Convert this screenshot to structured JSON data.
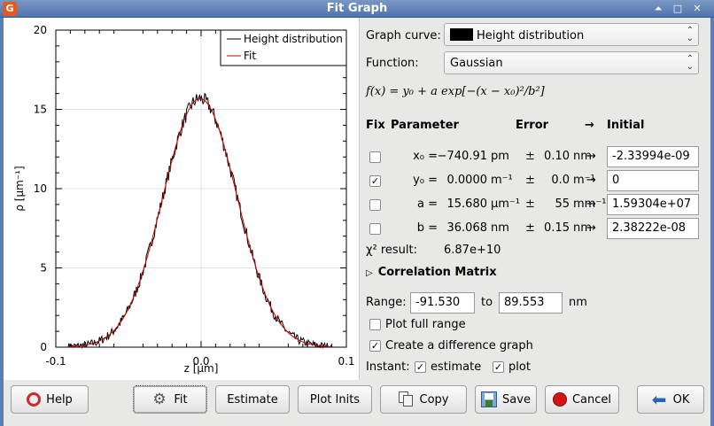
{
  "window": {
    "title": "Fit Graph"
  },
  "graph_curve": {
    "label": "Graph curve:",
    "value": "Height distribution"
  },
  "function": {
    "label": "Function:",
    "value": "Gaussian"
  },
  "formula": "f(x) = y₀ + a exp[−(x − x₀)²/b²]",
  "table": {
    "headers": {
      "fix": "Fix",
      "parameter": "Parameter",
      "error": "Error",
      "arrow": "→",
      "initial": "Initial"
    },
    "rows": [
      {
        "param": "x₀ =",
        "value": "−740.91",
        "unit": "pm",
        "pm": "±",
        "error": "0.10",
        "err_unit": "nm",
        "arrow": "→",
        "initial": "-2.33994e-09",
        "fixed": false
      },
      {
        "param": "y₀ =",
        "value": "0.0000",
        "unit": "m⁻¹",
        "pm": "±",
        "error": "0.0",
        "err_unit": "m⁻¹",
        "arrow": "→",
        "initial": "0",
        "fixed": true
      },
      {
        "param": "a =",
        "value": "15.680",
        "unit": "µm⁻¹",
        "pm": "±",
        "error": "55",
        "err_unit": "mm⁻¹",
        "arrow": "→",
        "initial": "1.59304e+07",
        "fixed": false
      },
      {
        "param": "b =",
        "value": "36.068",
        "unit": "nm",
        "pm": "±",
        "error": "0.15",
        "err_unit": "nm",
        "arrow": "→",
        "initial": "2.38222e-08",
        "fixed": false
      }
    ]
  },
  "chi2": {
    "label": "χ² result:",
    "value": "6.87e+10"
  },
  "correlation": {
    "label": "Correlation Matrix",
    "expanded": false
  },
  "range": {
    "label": "Range:",
    "from": "-91.530",
    "to_label": "to",
    "to": "89.553",
    "unit": "nm"
  },
  "options": {
    "plot_full_range": {
      "label": "Plot full range",
      "checked": false
    },
    "difference_graph": {
      "label": "Create a difference graph",
      "checked": true
    },
    "instant_label": "Instant:",
    "estimate": {
      "label": "estimate",
      "checked": true
    },
    "plot": {
      "label": "plot",
      "checked": true
    }
  },
  "buttons": {
    "help": "Help",
    "fit": "Fit",
    "estimate": "Estimate",
    "plot_inits": "Plot Inits",
    "copy": "Copy",
    "save": "Save",
    "cancel": "Cancel",
    "ok": "OK"
  },
  "icons": {
    "help": "lifebuoy-icon",
    "fit": "gears-icon",
    "copy": "copy-icon",
    "save": "save-icon",
    "cancel": "stop-icon",
    "ok": "back-arrow-icon"
  },
  "chart_data": {
    "type": "line",
    "xlabel": "z [µm]",
    "ylabel": "ρ [µm⁻¹]",
    "xlim": [
      -0.1,
      0.1
    ],
    "ylim": [
      0,
      20
    ],
    "x_ticks": [
      "-0.1",
      "0.0",
      "0.1"
    ],
    "y_ticks": [
      "0",
      "5",
      "10",
      "15",
      "20"
    ],
    "legend_position": "top-right",
    "series": [
      {
        "name": "Height distribution",
        "color": "#000000"
      },
      {
        "name": "Fit",
        "color": "#cc0000"
      }
    ],
    "fit_params": {
      "x0": -0.00074,
      "y0": 0,
      "a": 15.68,
      "b": 0.036068
    },
    "data_x_range": [
      -0.0915,
      0.0896
    ]
  }
}
